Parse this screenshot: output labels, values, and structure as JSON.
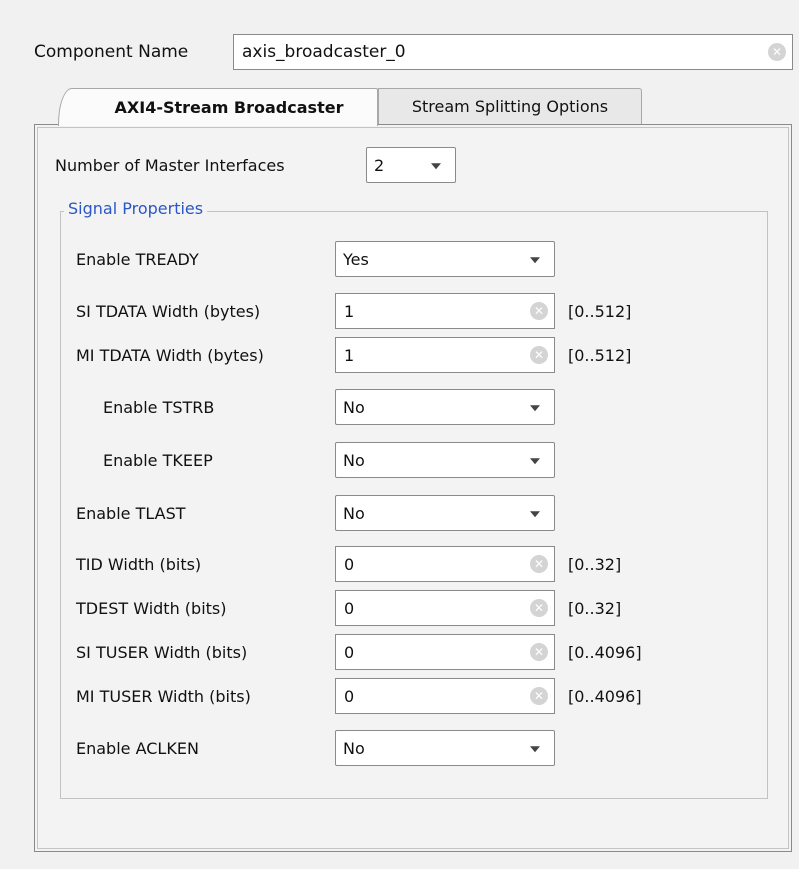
{
  "component": {
    "label": "Component Name",
    "value": "axis_broadcaster_0"
  },
  "tabs": [
    {
      "label": "AXI4-Stream Broadcaster",
      "active": true
    },
    {
      "label": "Stream Splitting Options",
      "active": false
    }
  ],
  "master": {
    "label": "Number of Master Interfaces",
    "value": "2"
  },
  "signal_properties": {
    "title": "Signal Properties",
    "rows": [
      {
        "label": "Enable TREADY",
        "type": "select",
        "value": "Yes"
      },
      {
        "label": "SI TDATA Width (bytes)",
        "type": "text",
        "value": "1",
        "range": "[0..512]"
      },
      {
        "label": "MI TDATA Width (bytes)",
        "type": "text",
        "value": "1",
        "range": "[0..512]"
      },
      {
        "label": "Enable TSTRB",
        "type": "select",
        "value": "No"
      },
      {
        "label": "Enable TKEEP",
        "type": "select",
        "value": "No"
      },
      {
        "label": "Enable TLAST",
        "type": "select",
        "value": "No"
      },
      {
        "label": "TID Width (bits)",
        "type": "text",
        "value": "0",
        "range": "[0..32]"
      },
      {
        "label": "TDEST Width (bits)",
        "type": "text",
        "value": "0",
        "range": "[0..32]"
      },
      {
        "label": "SI TUSER Width (bits)",
        "type": "text",
        "value": "0",
        "range": "[0..4096]"
      },
      {
        "label": "MI TUSER Width (bits)",
        "type": "text",
        "value": "0",
        "range": "[0..4096]"
      },
      {
        "label": "Enable ACLKEN",
        "type": "select",
        "value": "No"
      }
    ]
  },
  "icons": {
    "clear": "clear-icon",
    "dropdown": "chevron-down-icon"
  },
  "colors": {
    "group_title": "#2a56c6",
    "background": "#f1f1f1"
  }
}
